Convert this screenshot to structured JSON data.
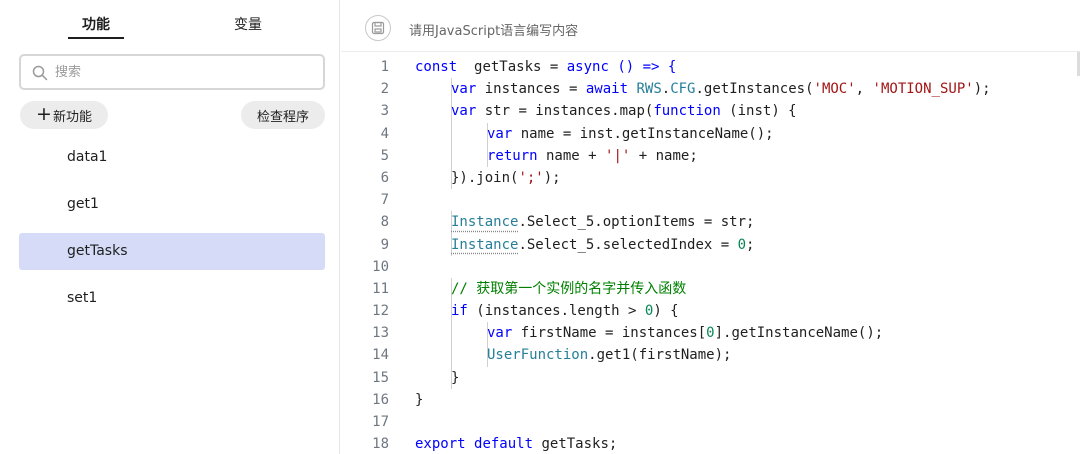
{
  "sidebar": {
    "tabs": [
      {
        "label": "功能",
        "active": true
      },
      {
        "label": "变量",
        "active": false
      }
    ],
    "search": {
      "placeholder": "搜索",
      "value": ""
    },
    "new_button": {
      "icon": "plus-icon",
      "label": "新功能"
    },
    "check_button": {
      "label": "检查程序"
    },
    "functions": [
      {
        "name": "data1",
        "selected": false
      },
      {
        "name": "get1",
        "selected": false
      },
      {
        "name": "getTasks",
        "selected": true
      },
      {
        "name": "set1",
        "selected": false
      }
    ]
  },
  "editor": {
    "save_icon": "save-icon",
    "hint": "请用JavaScript语言编写内容",
    "language": "JavaScript",
    "lines": [
      {
        "n": "1",
        "indent": 0,
        "tokens": [
          [
            "kw",
            "const"
          ],
          [
            "",
            "  getTasks = "
          ],
          [
            "kw",
            "async"
          ],
          [
            "kw",
            " () => {"
          ]
        ]
      },
      {
        "n": "2",
        "indent": 1,
        "tokens": [
          [
            "kw",
            "var"
          ],
          [
            "",
            " instances = "
          ],
          [
            "kw",
            "await"
          ],
          [
            "",
            " "
          ],
          [
            "type",
            "RWS"
          ],
          [
            "",
            "."
          ],
          [
            "type",
            "CFG"
          ],
          [
            "",
            ".getInstances("
          ],
          [
            "str",
            "'MOC'"
          ],
          [
            "",
            ", "
          ],
          [
            "str",
            "'MOTION_SUP'"
          ],
          [
            "",
            ");"
          ]
        ]
      },
      {
        "n": "3",
        "indent": 1,
        "tokens": [
          [
            "kw",
            "var"
          ],
          [
            "",
            " str = instances.map("
          ],
          [
            "kw",
            "function"
          ],
          [
            "",
            " (inst) {"
          ]
        ]
      },
      {
        "n": "4",
        "indent": 2,
        "tokens": [
          [
            "kw",
            "var"
          ],
          [
            "",
            " name = inst.getInstanceName();"
          ]
        ]
      },
      {
        "n": "5",
        "indent": 2,
        "tokens": [
          [
            "kw",
            "return"
          ],
          [
            "",
            " name + "
          ],
          [
            "str",
            "'|'"
          ],
          [
            "",
            " + name;"
          ]
        ]
      },
      {
        "n": "6",
        "indent": 1,
        "tokens": [
          [
            "",
            "}).join("
          ],
          [
            "str",
            "';'"
          ],
          [
            "",
            ");"
          ]
        ]
      },
      {
        "n": "7",
        "indent": 0,
        "tokens": []
      },
      {
        "n": "8",
        "indent": 1,
        "tokens": [
          [
            "type",
            "Instance"
          ],
          [
            "",
            ".Select_5.optionItems = str;"
          ]
        ]
      },
      {
        "n": "9",
        "indent": 1,
        "tokens": [
          [
            "type",
            "Instance"
          ],
          [
            "",
            ".Select_5.selectedIndex = "
          ],
          [
            "num",
            "0"
          ],
          [
            "",
            ";"
          ]
        ]
      },
      {
        "n": "10",
        "indent": 0,
        "tokens": []
      },
      {
        "n": "11",
        "indent": 1,
        "tokens": [
          [
            "cm",
            "// 获取第一个实例的名字并传入函数"
          ]
        ]
      },
      {
        "n": "12",
        "indent": 1,
        "tokens": [
          [
            "kw",
            "if"
          ],
          [
            "",
            " (instances.length > "
          ],
          [
            "num",
            "0"
          ],
          [
            "",
            ") {"
          ]
        ]
      },
      {
        "n": "13",
        "indent": 2,
        "tokens": [
          [
            "kw",
            "var"
          ],
          [
            "",
            " firstName = instances["
          ],
          [
            "num",
            "0"
          ],
          [
            "",
            "].getInstanceName();"
          ]
        ]
      },
      {
        "n": "14",
        "indent": 2,
        "tokens": [
          [
            "type",
            "UserFunction"
          ],
          [
            "",
            ".get1(firstName);"
          ]
        ]
      },
      {
        "n": "15",
        "indent": 1,
        "tokens": [
          [
            "",
            "}"
          ]
        ]
      },
      {
        "n": "16",
        "indent": 0,
        "tokens": [
          [
            "",
            "}"
          ]
        ]
      },
      {
        "n": "17",
        "indent": 0,
        "tokens": []
      },
      {
        "n": "18",
        "indent": 0,
        "tokens": [
          [
            "kw",
            "export"
          ],
          [
            "",
            " "
          ],
          [
            "kw",
            "default"
          ],
          [
            "",
            " getTasks;"
          ]
        ]
      }
    ]
  }
}
